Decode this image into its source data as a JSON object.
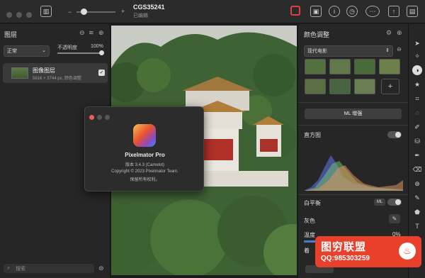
{
  "toolbar": {
    "doc_title": "CGS35241",
    "doc_status": "已编辑"
  },
  "layers_panel": {
    "title": "图层",
    "blend_mode": "正常",
    "opacity_label": "不透明度",
    "opacity_value": "100%",
    "layer_name": "图像图层",
    "layer_info": "5616 × 3744 px, 颜色调整",
    "search_placeholder": "搜索"
  },
  "about_dialog": {
    "app_name": "Pixelmator Pro",
    "version": "版本 3.4.3 (Camelot)",
    "copyright": "Copyright © 2023 Pixelmator Team.",
    "rights": "保留所有权利。"
  },
  "adjust_panel": {
    "title": "颜色调整",
    "preset": "现代电影",
    "ml_enhance": "ML 增强",
    "histogram_label": "直方图",
    "white_balance_label": "白平衡",
    "ml_badge": "ML",
    "gray_label": "灰色",
    "temperature_label": "温度",
    "temperature_value": "0%",
    "tint_label": "着"
  },
  "watermark": {
    "title": "图穷联盟",
    "qq": "QQ:985303259"
  },
  "colors": {
    "accent": "#e8402a",
    "panel": "#262626"
  }
}
